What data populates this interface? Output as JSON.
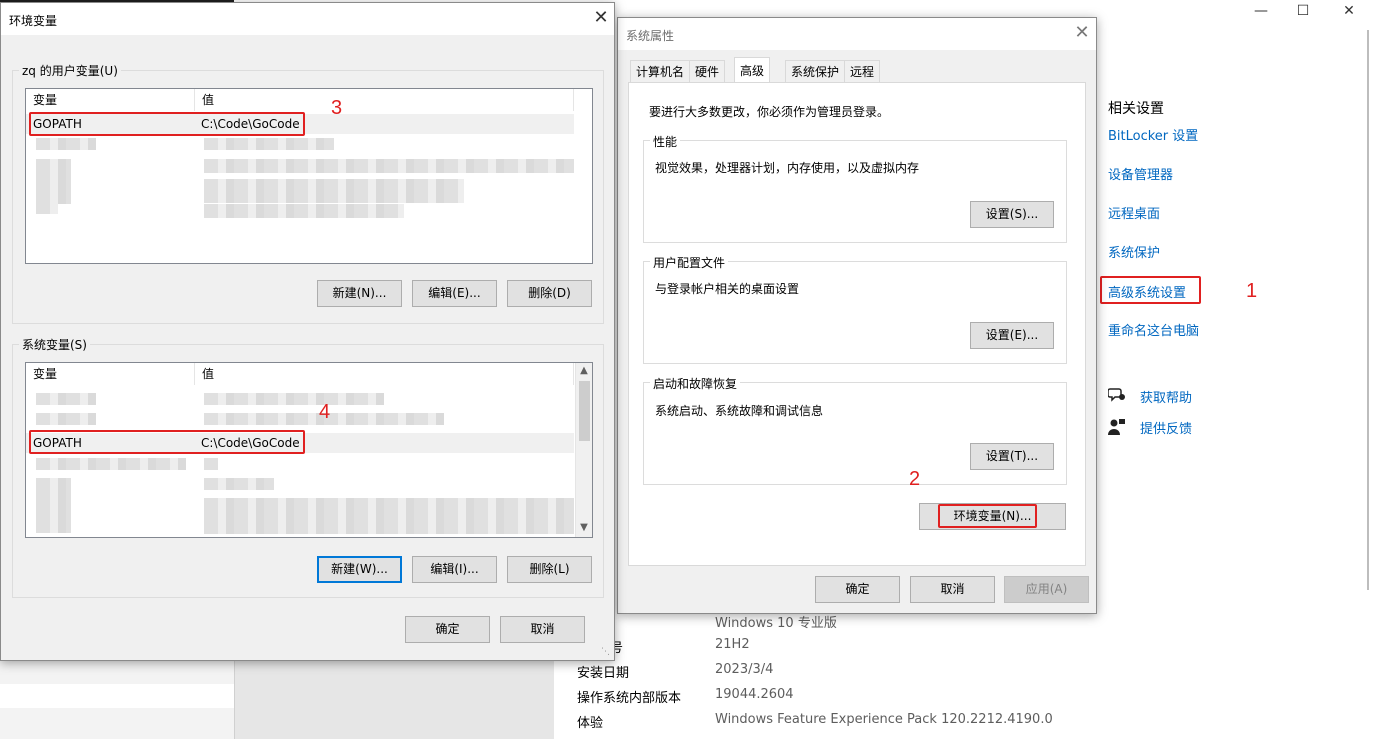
{
  "settings_window": {
    "controls": {
      "minimize": "—",
      "maximize": "☐",
      "close": "✕"
    },
    "related": {
      "title": "相关设置",
      "links": [
        "BitLocker 设置",
        "设备管理器",
        "远程桌面",
        "系统保护",
        "高级系统设置",
        "重命名这台电脑"
      ]
    },
    "help": {
      "get_help": "获取帮助",
      "feedback": "提供反馈"
    },
    "specs": [
      {
        "label": "",
        "value": "Windows 10 专业版"
      },
      {
        "label": "号",
        "value": "21H2"
      },
      {
        "label": "安装日期",
        "value": "2023/3/4"
      },
      {
        "label": "操作系统内部版本",
        "value": "19044.2604"
      },
      {
        "label": "体验",
        "value": "Windows Feature Experience Pack 120.2212.4190.0"
      }
    ]
  },
  "sysprops": {
    "title": "系统属性",
    "close": "✕",
    "tabs": [
      "计算机名",
      "硬件",
      "高级",
      "系统保护",
      "远程"
    ],
    "active_tab": "高级",
    "admin_note": "要进行大多数更改，你必须作为管理员登录。",
    "perf": {
      "label": "性能",
      "desc": "视觉效果，处理器计划，内存使用，以及虚拟内存",
      "button": "设置(S)..."
    },
    "profile": {
      "label": "用户配置文件",
      "desc": "与登录帐户相关的桌面设置",
      "button": "设置(E)..."
    },
    "startup": {
      "label": "启动和故障恢复",
      "desc": "系统启动、系统故障和调试信息",
      "button": "设置(T)..."
    },
    "env_button": "环境变量(N)...",
    "ok": "确定",
    "cancel": "取消",
    "apply": "应用(A)"
  },
  "envvars": {
    "title": "环境变量",
    "close": "✕",
    "user_group": "zq 的用户变量(U)",
    "system_group": "系统变量(S)",
    "col_var": "变量",
    "col_val": "值",
    "user_row": {
      "var": "GOPATH",
      "val": "C:\\Code\\GoCode"
    },
    "sys_row": {
      "var": "GOPATH",
      "val": "C:\\Code\\GoCode"
    },
    "user_buttons": {
      "new": "新建(N)...",
      "edit": "编辑(E)...",
      "delete": "删除(D)"
    },
    "sys_buttons": {
      "new": "新建(W)...",
      "edit": "编辑(I)...",
      "delete": "删除(L)"
    },
    "ok": "确定",
    "cancel": "取消"
  },
  "annotations": {
    "a1": "1",
    "a2": "2",
    "a3": "3",
    "a4": "4"
  },
  "colors": {
    "annotation": "#e02020",
    "link": "#0067c0",
    "focus": "#0078d7"
  }
}
